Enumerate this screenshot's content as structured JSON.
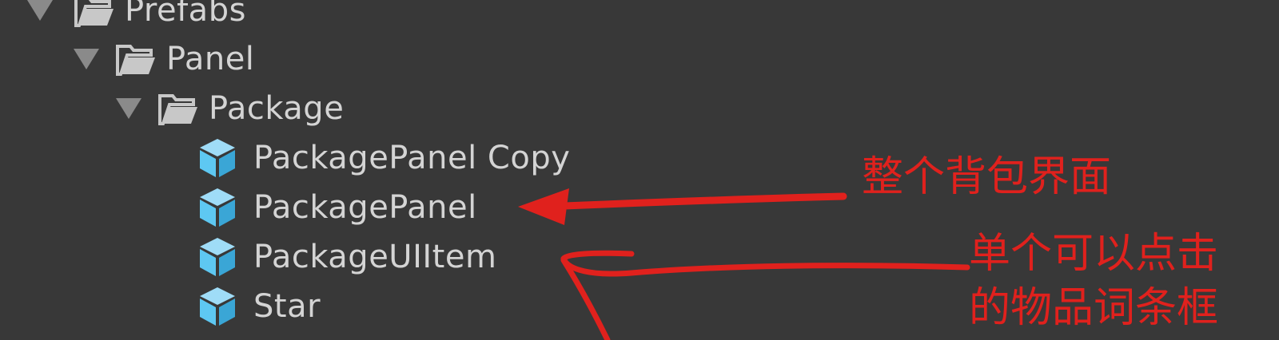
{
  "tree": {
    "items": [
      {
        "label": "Prefabs",
        "type": "folder"
      },
      {
        "label": "Panel",
        "type": "folder"
      },
      {
        "label": "Package",
        "type": "folder"
      },
      {
        "label": "PackagePanel Copy",
        "type": "prefab"
      },
      {
        "label": "PackagePanel",
        "type": "prefab"
      },
      {
        "label": "PackageUIItem",
        "type": "prefab"
      },
      {
        "label": "Star",
        "type": "prefab"
      }
    ]
  },
  "annotations": {
    "panel_note": "整个背包界面",
    "item_note_line1": "单个可以点击",
    "item_note_line2": "的物品词条框"
  },
  "colors": {
    "background": "#383838",
    "text": "#d4d4d4",
    "annotation_red": "#e0211d",
    "prefab_blue": "#5ec8f2"
  },
  "icons": {
    "folder": "open-folder-icon",
    "prefab": "prefab-cube-icon",
    "expand": "triangle-down-icon"
  }
}
